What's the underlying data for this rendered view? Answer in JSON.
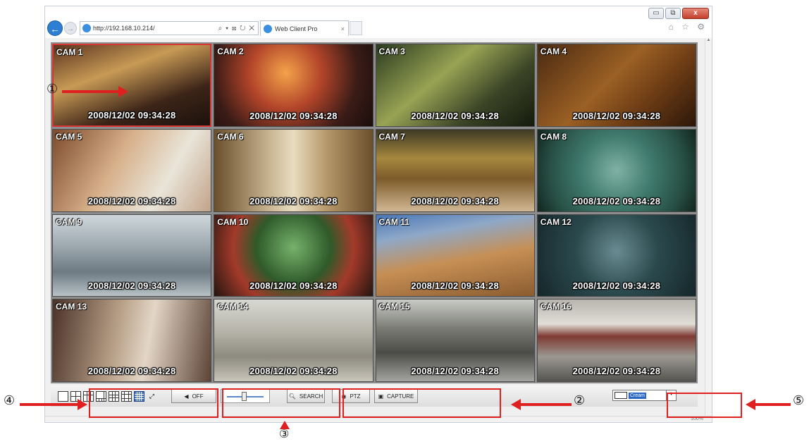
{
  "browser": {
    "url": "http://192.168.10.214/",
    "address_tools": "⌕ ▾ ⊠ ↻ ✕",
    "tab_title": "Web Client Pro",
    "tab_close": "×",
    "right_icons": "⌂ ☆ ⚙",
    "window_buttons": [
      "▭",
      "⧉",
      "x"
    ],
    "zoom": "100%"
  },
  "cameras": [
    {
      "name": "CAM 1",
      "timestamp": "2008/12/02  09:34:28"
    },
    {
      "name": "CAM 2",
      "timestamp": "2008/12/02  09:34:28"
    },
    {
      "name": "CAM 3",
      "timestamp": "2008/12/02  09:34:28"
    },
    {
      "name": "CAM 4",
      "timestamp": "2008/12/02  09:34:28"
    },
    {
      "name": "CAM 5",
      "timestamp": "2008/12/02  09:34:28"
    },
    {
      "name": "CAM 6",
      "timestamp": "2008/12/02  09:34:28"
    },
    {
      "name": "CAM 7",
      "timestamp": "2008/12/02  09:34:28"
    },
    {
      "name": "CAM 8",
      "timestamp": "2008/12/02  09:34:28"
    },
    {
      "name": "CAM 9",
      "timestamp": "2008/12/02  09:34:28"
    },
    {
      "name": "CAM 10",
      "timestamp": "2008/12/02  09:34:28"
    },
    {
      "name": "CAM 11",
      "timestamp": "2008/12/02  09:34:28"
    },
    {
      "name": "CAM 12",
      "timestamp": "2008/12/02  09:34:28"
    },
    {
      "name": "CAM 13",
      "timestamp": "2008/12/02  09:34:28"
    },
    {
      "name": "CAM 14",
      "timestamp": "2008/12/02  09:34:28"
    },
    {
      "name": "CAM 15",
      "timestamp": "2008/12/02  09:34:28"
    },
    {
      "name": "CAM 16",
      "timestamp": "2008/12/02  09:34:28"
    }
  ],
  "controls": {
    "audio_label": "OFF",
    "search_label": "SEARCH",
    "ptz_label": "PTZ",
    "capture_label": "CAPTURE",
    "color_label": "Cream",
    "volume_level": 0.45
  },
  "annotations": {
    "n1": "①",
    "n2": "②",
    "n3": "③",
    "n4": "④",
    "n5": "⑤"
  },
  "colors": {
    "callout": "#e02020",
    "active_camera_border": "#d93434",
    "selected_layout": "#4b78c8"
  }
}
